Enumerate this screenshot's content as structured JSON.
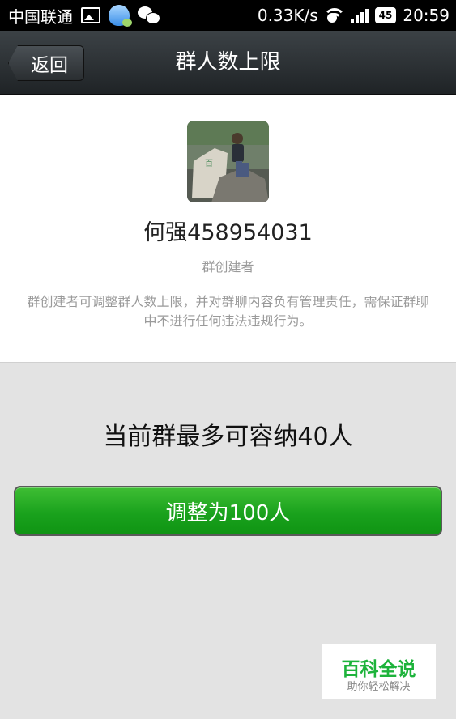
{
  "status_bar": {
    "carrier": "中国联通",
    "network_speed": "0.33K/s",
    "battery": "45",
    "time": "20:59"
  },
  "header": {
    "back_label": "返回",
    "title": "群人数上限"
  },
  "profile": {
    "name": "何强458954031",
    "role": "群创建者",
    "description": "群创建者可调整群人数上限，并对群聊内容负有管理责任，需保证群聊中不进行任何违法违规行为。"
  },
  "main": {
    "capacity_text": "当前群最多可容纳40人",
    "adjust_button": "调整为100人"
  },
  "watermark": {
    "title": "百科全说",
    "subtitle": "助你轻松解决"
  }
}
